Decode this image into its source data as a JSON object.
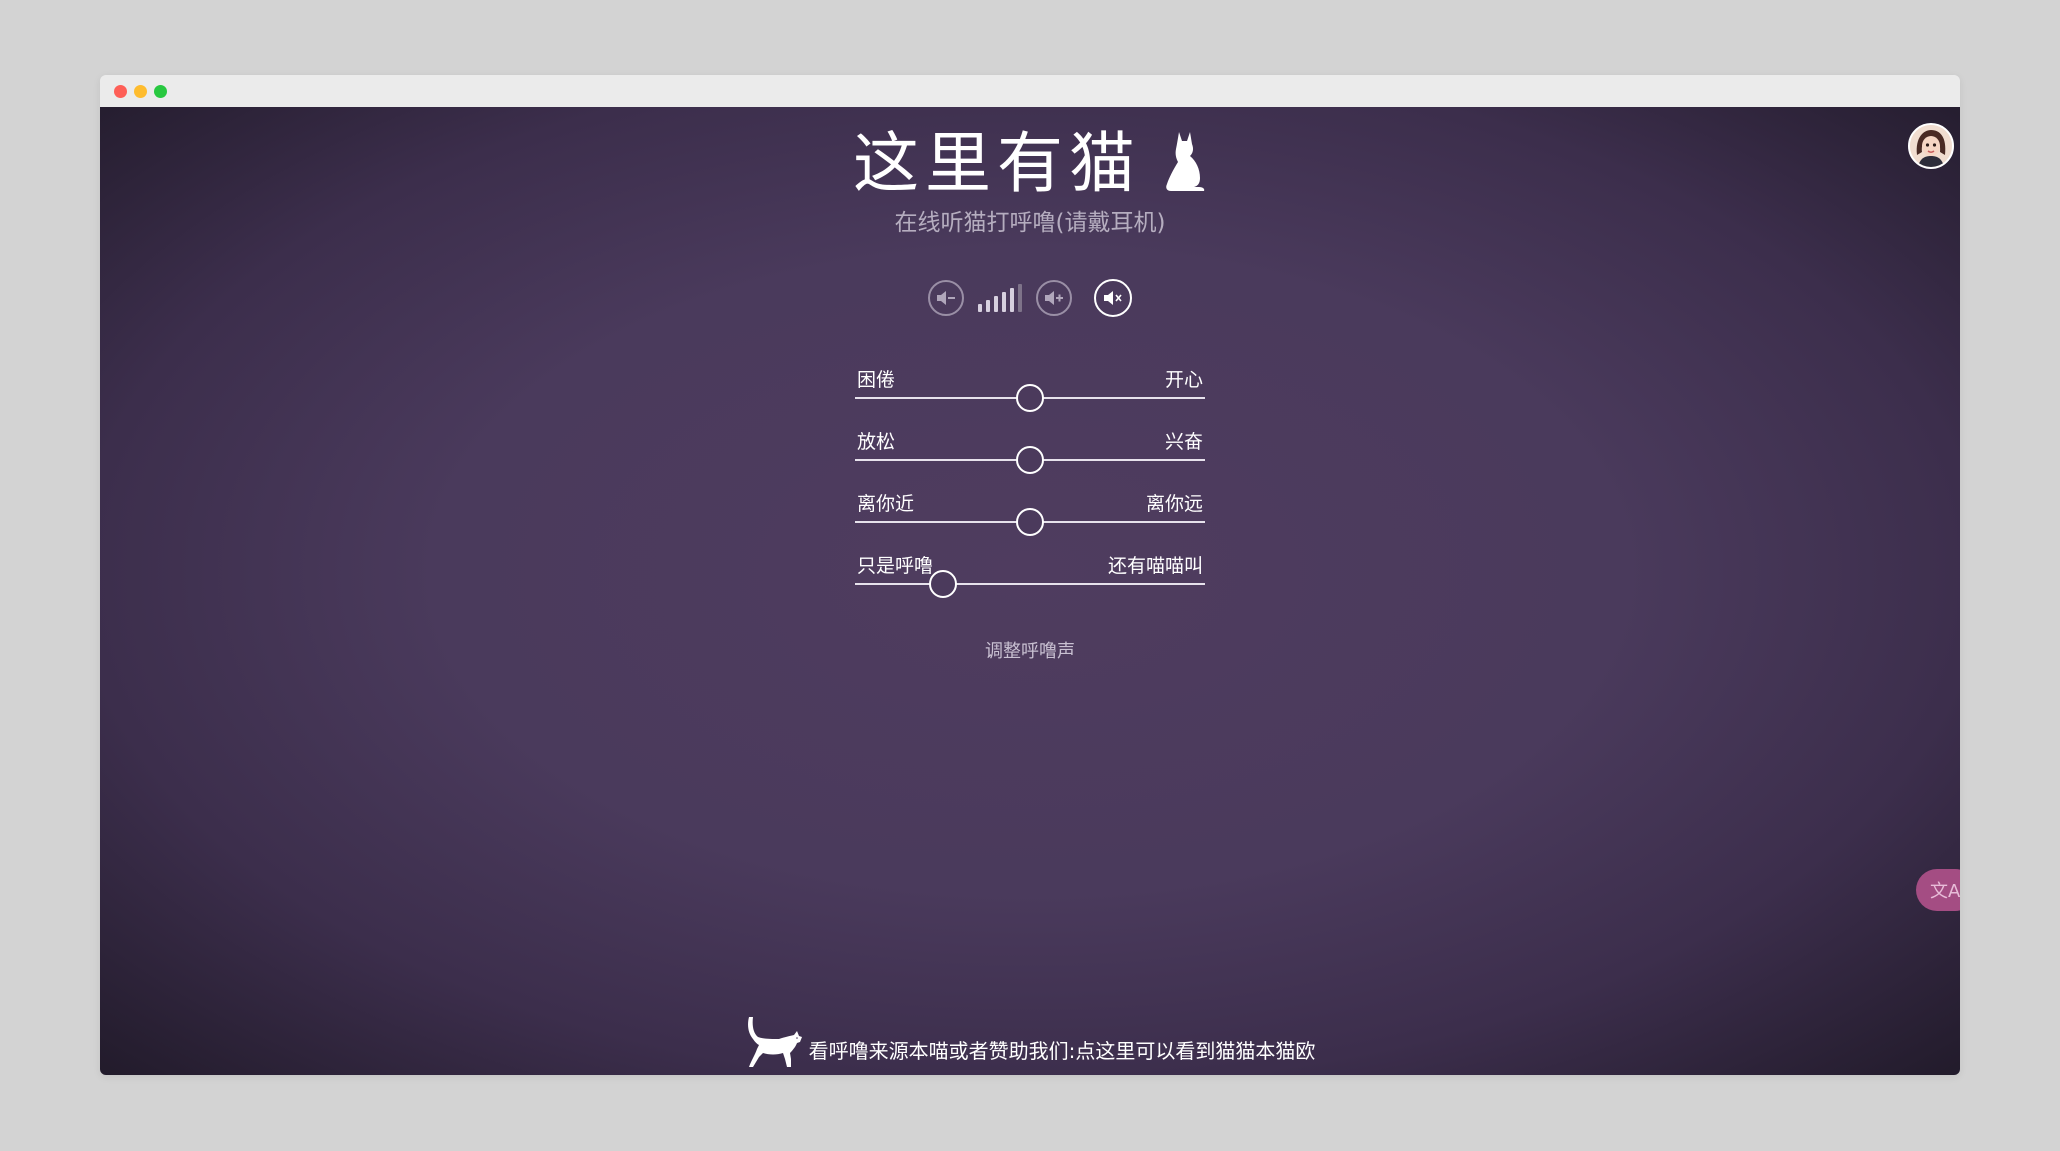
{
  "window": {
    "controls": [
      "close",
      "minimize",
      "zoom"
    ]
  },
  "header": {
    "title": "这里有猫",
    "title_icon": "cat-silhouette-icon",
    "subtitle": "在线听猫打呼噜(请戴耳机)"
  },
  "volume": {
    "decrease_icon": "volume-down-icon",
    "increase_icon": "volume-up-icon",
    "mute_icon": "mute-icon",
    "level": 5,
    "max_level": 6
  },
  "sliders": [
    {
      "left_label": "困倦",
      "right_label": "开心",
      "value": 0.5
    },
    {
      "left_label": "放松",
      "right_label": "兴奋",
      "value": 0.5
    },
    {
      "left_label": "离你近",
      "right_label": "离你远",
      "value": 0.5
    },
    {
      "left_label": "只是呼噜",
      "right_label": "还有喵喵叫",
      "value": 0.25
    }
  ],
  "adjust_label": "调整呼噜声",
  "footer": {
    "text": "看呼噜来源本喵或者赞助我们:点这里可以看到猫猫本猫欧",
    "icon": "walking-cat-icon"
  },
  "translate_button": {
    "label": "文A",
    "icon": "translate-icon"
  },
  "colors": {
    "background": "#4a3a5c",
    "accent_pink": "#a44d83",
    "text": "#ffffff",
    "subtitle": "#b5adbf"
  }
}
